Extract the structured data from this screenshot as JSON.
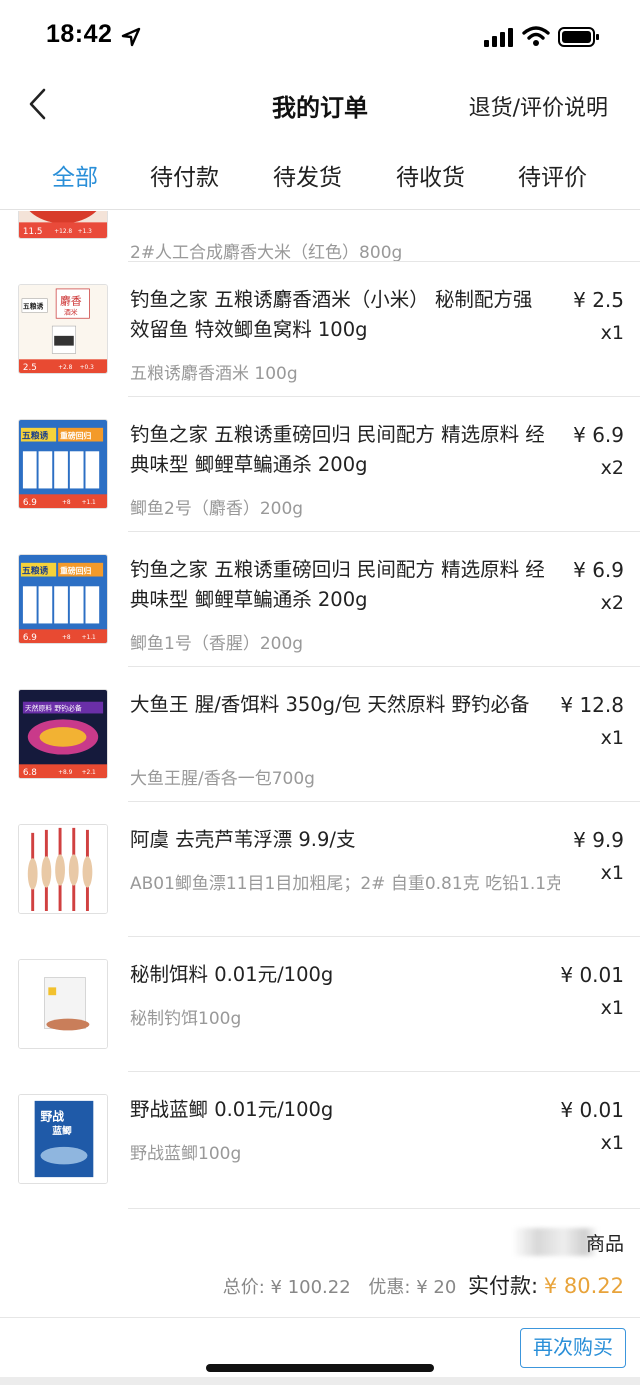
{
  "status_bar": {
    "time": "18:42"
  },
  "nav": {
    "title": "我的订单",
    "right_link": "退货/评价说明"
  },
  "tabs": [
    {
      "label": "全部",
      "active": true
    },
    {
      "label": "待付款",
      "active": false
    },
    {
      "label": "待发货",
      "active": false
    },
    {
      "label": "待收货",
      "active": false
    },
    {
      "label": "待评价",
      "active": false
    }
  ],
  "items": [
    {
      "title": "",
      "spec": "2#人工合成麝香大米（红色）800g",
      "price": "",
      "qty": "",
      "thumb_label": [
        "11.5",
        "+12.8",
        "+1.3"
      ]
    },
    {
      "title": "钓鱼之家 五粮诱麝香酒米（小米） 秘制配方强效留鱼 特效鲫鱼窝料 100g",
      "spec": "五粮诱麝香酒米 100g",
      "price": "¥ 2.5",
      "qty": "x1",
      "thumb_label": [
        "五粮诱",
        "麝香",
        "酒米",
        "2.5",
        "+2.8",
        "+0.3"
      ]
    },
    {
      "title": "钓鱼之家 五粮诱重磅回归 民间配方 精选原料 经典味型  鲫鲤草鳊通杀 200g",
      "spec": "鲫鱼2号（麝香）200g",
      "price": "¥ 6.9",
      "qty": "x2",
      "thumb_label": [
        "五粮诱",
        "重磅回归",
        "6.9",
        "+8",
        "+1.1"
      ]
    },
    {
      "title": "钓鱼之家 五粮诱重磅回归 民间配方 精选原料 经典味型  鲫鲤草鳊通杀 200g",
      "spec": "鲫鱼1号（香腥）200g",
      "price": "¥ 6.9",
      "qty": "x2",
      "thumb_label": [
        "五粮诱",
        "重磅回归",
        "6.9",
        "+8",
        "+1.1"
      ]
    },
    {
      "title": "大鱼王 腥/香饵料 350g/包 天然原料 野钓必备",
      "spec": "大鱼王腥/香各一包700g",
      "price": "¥ 12.8",
      "qty": "x1",
      "thumb_label": [
        "天然原料 野钓必备",
        "6.8",
        "+8.9",
        "+2.1"
      ]
    },
    {
      "title": "阿虞 去壳芦苇浮漂 9.9/支",
      "spec": "AB01鲫鱼漂11目1目加粗尾；2# 自重0.81克 吃铅1.1克",
      "price": "¥ 9.9",
      "qty": "x1",
      "thumb_label": []
    },
    {
      "title": "秘制饵料 0.01元/100g",
      "spec": "秘制钓饵100g",
      "price": "¥ 0.01",
      "qty": "x1",
      "thumb_label": []
    },
    {
      "title": "野战蓝鲫 0.01元/100g",
      "spec": "野战蓝鲫100g",
      "price": "¥ 0.01",
      "qty": "x1",
      "thumb_label": [
        "野战",
        "蓝鲫"
      ]
    }
  ],
  "summary": {
    "more_label": "商品",
    "total_label": "总价: ¥ 100.22",
    "discount_label": "优惠: ¥ 20",
    "paid_label": "实付款:",
    "paid_value": "¥ 80.22"
  },
  "actions": {
    "rebuy": "再次购买"
  },
  "colors": {
    "accent": "#2a8fd8",
    "paid": "#e8a33a",
    "muted": "#999999"
  }
}
